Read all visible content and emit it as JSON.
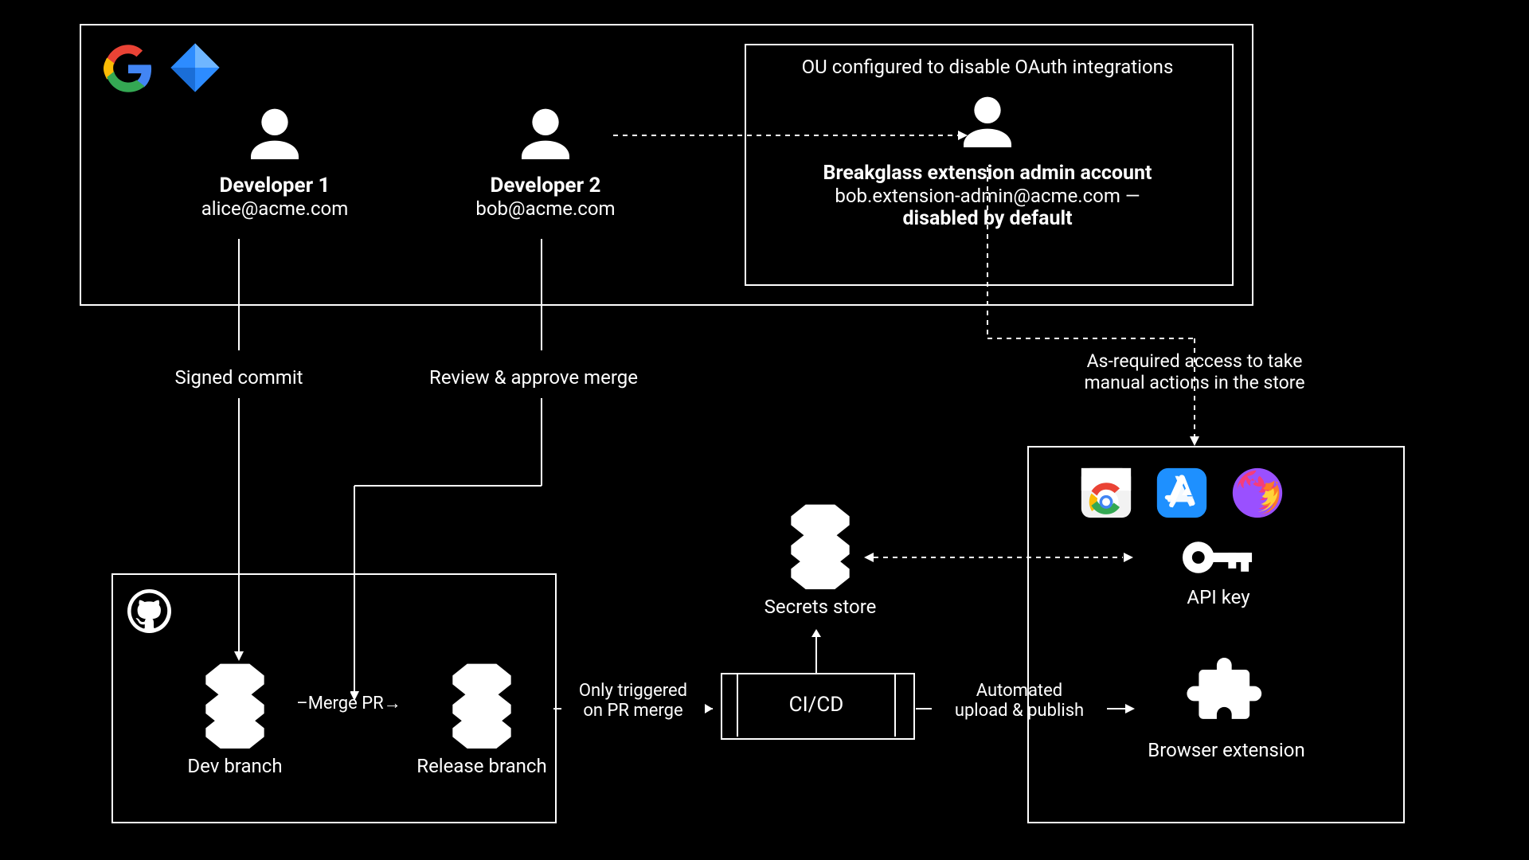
{
  "top": {
    "ou_text": "OU configured to disable OAuth integrations",
    "dev1": {
      "title": "Developer 1",
      "email": "alice@acme.com"
    },
    "dev2": {
      "title": "Developer 2",
      "email": "bob@acme.com"
    },
    "breakglass": {
      "title": "Breakglass extension admin account",
      "email_line": "bob.extension-admin@acme.com —",
      "status": "disabled by default"
    }
  },
  "arrows": {
    "signed_commit": "Signed commit",
    "review_approve": "Review & approve merge",
    "store_access": "As-required access to take\nmanual actions in the store",
    "merge_pr": "–Merge PR→",
    "only_triggered": "Only triggered\non PR merge",
    "automated": "Automated\nupload & publish"
  },
  "nodes": {
    "dev_branch": "Dev branch",
    "release_branch": "Release branch",
    "secrets": "Secrets store",
    "cicd": "CI/CD",
    "apikey": "API key",
    "browser_ext": "Browser extension"
  },
  "colors": {
    "google_red": "#EA4335",
    "google_yellow": "#FBBC05",
    "google_green": "#34A853",
    "google_blue": "#4285F4",
    "azure_blue": "#2D8CFF",
    "appstore_blue": "#1E90FF",
    "firefox_purple": "#9A50FF",
    "firefox_orange": "#FF7F1E",
    "firefox_yellow": "#FFD93B"
  }
}
